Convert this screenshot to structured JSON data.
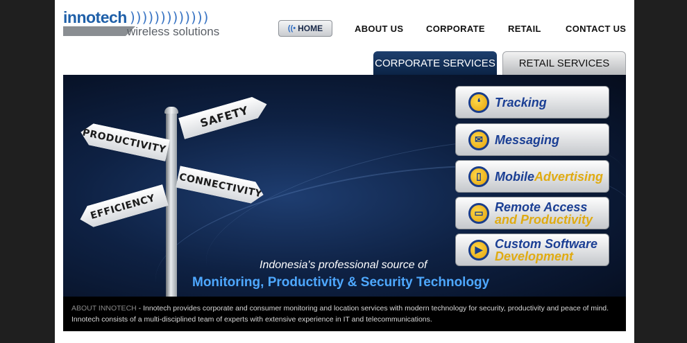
{
  "logo": {
    "main": "innotech",
    "waves": ")))))))))))))",
    "sub": "wireless solutions"
  },
  "nav": {
    "home": "HOME",
    "items": [
      "ABOUT US",
      "CORPORATE",
      "RETAIL",
      "CONTACT US"
    ]
  },
  "tabs": {
    "corporate": "CORPORATE SERVICES",
    "retail": "RETAIL SERVICES"
  },
  "banner": {
    "signs": [
      "SAFETY",
      "PRODUCTIVITY",
      "CONNECTIVITY",
      "EFFICIENCY"
    ],
    "tagline_line1": "Indonesia's professional source of",
    "tagline_line2": "Monitoring, Productivity & Security Technology"
  },
  "services": [
    {
      "line1": "Tracking",
      "line2": "",
      "icon": "footprints-icon"
    },
    {
      "line1": "Messaging",
      "line2": "",
      "icon": "envelope-icon"
    },
    {
      "line1": "Mobile",
      "line1b": "Advertising",
      "line2": "",
      "icon": "phone-icon"
    },
    {
      "line1": "Remote Access",
      "line2": "and Productivity",
      "icon": "monitor-icon"
    },
    {
      "line1": "Custom Software",
      "line2": "Development",
      "icon": "play-icon"
    }
  ],
  "about": {
    "title": "ABOUT INNOTECH",
    "text": " - Innotech provides corporate and consumer monitoring and location services with modern technology for security, productivity and peace of mind. Innotech consists of a multi-disciplined team of experts with extensive experience in IT and telecommunications."
  },
  "colors": {
    "brand_blue": "#1e5fa8",
    "banner_bg": "#0e2143",
    "accent_yellow": "#e0ab12"
  }
}
